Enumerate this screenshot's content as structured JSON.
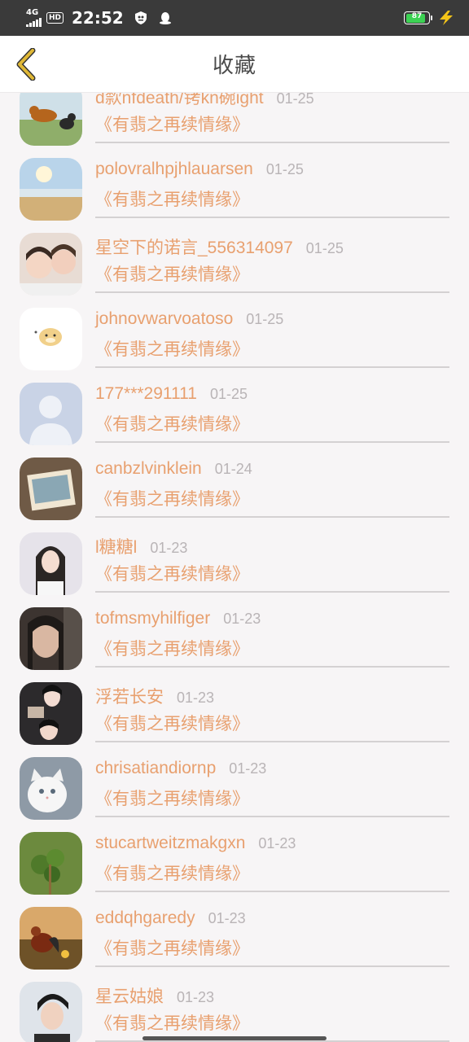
{
  "status_bar": {
    "network": "4G",
    "hd": "HD",
    "time": "22:52",
    "battery": "87",
    "icons": [
      "signal-icon",
      "hd-icon",
      "shield-app-icon",
      "qq-penguin-icon",
      "battery-icon",
      "charging-icon"
    ]
  },
  "nav": {
    "title": "收藏",
    "back_icon": "chevron-left-icon"
  },
  "colors": {
    "accent": "#e8a06f",
    "date": "#b9b4b6",
    "back": "#e0b836"
  },
  "items": [
    {
      "name": "d歀nfdeath/铐kn碗ight",
      "date": "01-25",
      "book": "《有翡之再续情缘》",
      "avatar": "dogs-running"
    },
    {
      "name": "polovralhpjhlauarsen",
      "date": "01-25",
      "book": "《有翡之再续情缘》",
      "avatar": "beach-sunset"
    },
    {
      "name": "星空下的诺言_556314097",
      "date": "01-25",
      "book": "《有翡之再续情缘》",
      "avatar": "two-girls"
    },
    {
      "name": "johnovwarvoatoso",
      "date": "01-25",
      "book": "《有翡之再续情缘》",
      "avatar": "cartoon-hamster"
    },
    {
      "name": "177***291111",
      "date": "01-25",
      "book": "《有翡之再续情缘》",
      "avatar": "default-person"
    },
    {
      "name": "canbzlvinklein",
      "date": "01-24",
      "book": "《有翡之再续情缘》",
      "avatar": "photo-frame"
    },
    {
      "name": "l糖糖l",
      "date": "01-23",
      "book": "《有翡之再续情缘》",
      "avatar": "girl-portrait"
    },
    {
      "name": "tofmsmyhilfiger",
      "date": "01-23",
      "book": "《有翡之再续情缘》",
      "avatar": "woman-closeup"
    },
    {
      "name": "浮若长安",
      "date": "01-23",
      "book": "《有翡之再续情缘》",
      "avatar": "costume-actress"
    },
    {
      "name": "chrisatiandiornp",
      "date": "01-23",
      "book": "《有翡之再续情缘》",
      "avatar": "white-cat"
    },
    {
      "name": "stucartweitzmakgxn",
      "date": "01-23",
      "book": "《有翡之再续情缘》",
      "avatar": "green-plant"
    },
    {
      "name": "eddqhgaredy",
      "date": "01-23",
      "book": "《有翡之再续情缘》",
      "avatar": "rooster-sunset"
    },
    {
      "name": "星云姑娘",
      "date": "01-23",
      "book": "《有翡之再续情缘》",
      "avatar": "young-man"
    }
  ]
}
